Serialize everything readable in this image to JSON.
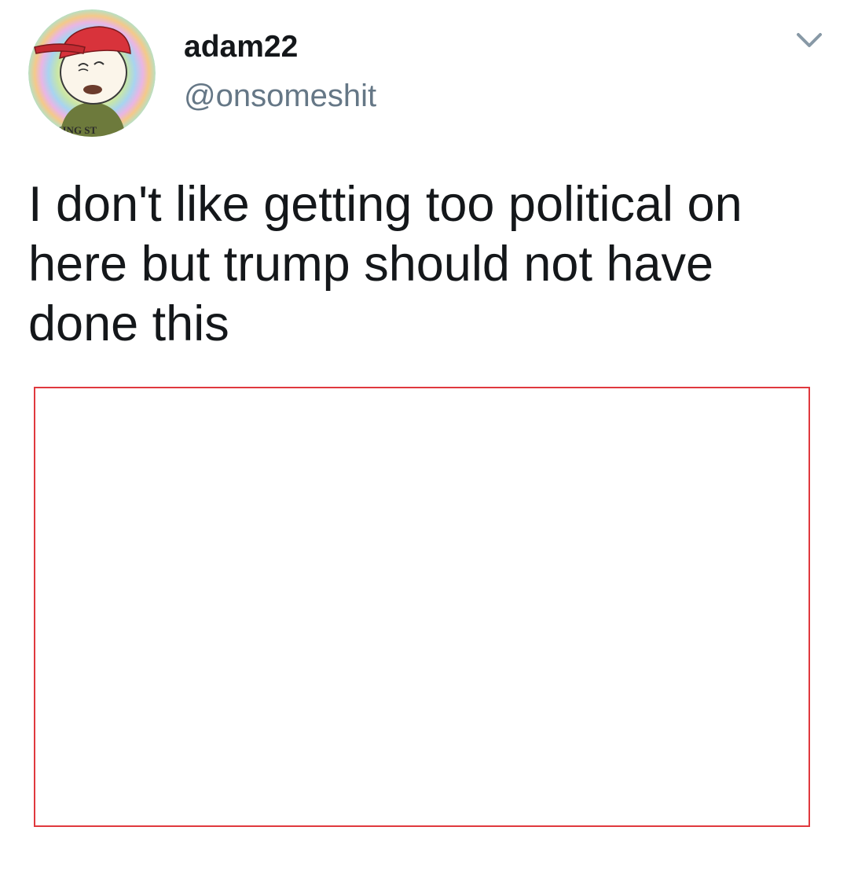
{
  "tweet": {
    "author": {
      "display_name": "adam22",
      "handle": "@onsomeshit",
      "avatar_icon": "cartoon-avatar",
      "avatar_caption": "CKING ST"
    },
    "menu_icon": "chevron-down-icon",
    "text": "I don't like getting too political on here but trump should not have done this",
    "media": {
      "frame_color": "#e0393e"
    }
  }
}
